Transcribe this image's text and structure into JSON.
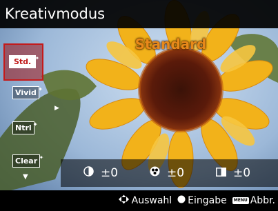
{
  "window": {
    "title": "Kreativmodus"
  },
  "selected_style": {
    "label": "Standard"
  },
  "styles": [
    {
      "label": "Std.",
      "selected": true
    },
    {
      "label": "Vivid",
      "selected": false
    },
    {
      "label": "Ntrl",
      "selected": false
    },
    {
      "label": "Clear",
      "selected": false
    }
  ],
  "params": {
    "contrast": {
      "icon": "contrast-icon",
      "value": "±0"
    },
    "saturation": {
      "icon": "saturation-icon",
      "value": "±0"
    },
    "sharpness": {
      "icon": "sharpness-icon",
      "value": "±0"
    }
  },
  "nav": {
    "select_label": "Auswahl",
    "enter_label": "Eingabe",
    "menu_chip": "MENU",
    "cancel_label": "Abbr."
  },
  "colors": {
    "accent": "#c41a1a",
    "mode_label": "#e8891a"
  }
}
